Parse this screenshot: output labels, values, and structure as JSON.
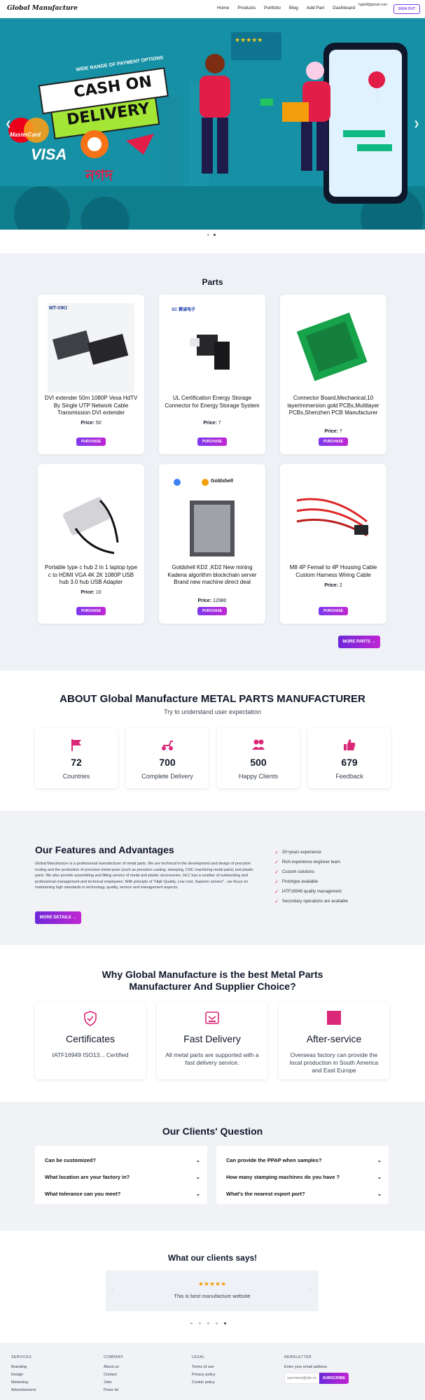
{
  "nav": {
    "brand": "Global Manufacture",
    "links": [
      "Home",
      "Products",
      "Portfolio",
      "Blog",
      "Add Part",
      "Dashboard"
    ],
    "email": "hyjbdl@gmail.com",
    "signout": "SIGN OUT"
  },
  "hero": {
    "banner_top": "WIDE RANGE OF PAYMENT OPTIONS",
    "cash": "CASH ON",
    "delivery": "DELIVERY",
    "visa": "VISA",
    "mastercard": "MasterCard",
    "bangla": "নগদ",
    "stars": "★★★★★",
    "slides": 2,
    "active_slide": 2
  },
  "parts": {
    "title": "Parts",
    "price_label": "Price:",
    "purchase_label": "PURCHASE",
    "more_label": "MORE PARTS",
    "items": [
      {
        "name": "DVI extender 50m 1080P Vesa HdTV By Single UTP Network Cable Transmission DVI extender",
        "price": "50",
        "logo": "MT-VIKI"
      },
      {
        "name": "UL Certification Energy Storage Connector for Energy Storage System",
        "price": "7",
        "logo": "SC 赛诚电子"
      },
      {
        "name": "Connector Board,Mechanical,10 layerImmersion gold PCBs,Multilayer PCBs,Shenzhen PCB Manufacturer",
        "price": "7",
        "logo": ""
      },
      {
        "name": "Portable type c hub 2 in 1 laptop type c to HDMI VGA 4K 2K 1080P USB hub 3.0 hub USB Adapter",
        "price": "10",
        "logo": ""
      },
      {
        "name": "Goldshell KD2 ,KD2 New mining Kadena algorithm blockchain server Brand new machine direct deal",
        "price": "12980",
        "logo": "Goldshell"
      },
      {
        "name": "M8 4P Femail to 4P Housing Cable Custom Harness Wiring Cable",
        "price": "2",
        "logo": ""
      }
    ]
  },
  "about": {
    "title": "ABOUT Global Manufacture METAL PARTS MANUFACTURER",
    "subtitle": "Try to understand user expectation",
    "stats": [
      {
        "num": "72",
        "label": "Countries",
        "icon": "flag-icon"
      },
      {
        "num": "700",
        "label": "Complete Delivery",
        "icon": "scooter-icon"
      },
      {
        "num": "500",
        "label": "Happy Clients",
        "icon": "users-icon"
      },
      {
        "num": "679",
        "label": "Feedback",
        "icon": "thumbs-up-icon"
      }
    ]
  },
  "features": {
    "title": "Our Features and Advantages",
    "body": "Global Manufacture is a professional manufacturer of metal parts. We are technical in the development and design of precision tooling and the production of precision metal parts (such as precision casting, stamping, CNC machining metal parts) and plastic parts. We also provide assembling and fitting service of metal and plastic accessories. HLC has a number of outstanding and professional management and technical employees. With principle of \"High Quality, Low cost, Superior service\" , we focus on maintaining high standards in technology, quality, service and management aspects.",
    "button": "MORE DETAILS",
    "checks": [
      "20+years experience",
      "Rich experience engineer team",
      "Custom solutions",
      "Prototype available",
      "IATF16949 quality management",
      "Secondary operations are available"
    ]
  },
  "why": {
    "title_line1": "Why Global Manufacture is the best Metal Parts",
    "title_line2": "Manufacturer And Supplier Choice?",
    "cards": [
      {
        "title": "Certificates",
        "desc": "IATF16949 ISO13... Certified",
        "icon": "shield-check-icon"
      },
      {
        "title": "Fast Delivery",
        "desc": "All metal parts are supported with a fast delivery service.",
        "icon": "truck-icon"
      },
      {
        "title": "After-service",
        "desc": "Overseas factory can provide the local production in South America and East Europe",
        "icon": "square-icon"
      }
    ]
  },
  "faq": {
    "title": "Our Clients' Question",
    "left": [
      "Can be customized?",
      "What location are your factory in?",
      "What tolerance can you meet?"
    ],
    "right": [
      "Can provide the PPAP when samples?",
      "How many stamping machines do you have ?",
      "What's the nearest export port?"
    ]
  },
  "testimonials": {
    "title": "What our clients says!",
    "stars": "★★★★★",
    "quote": "This is best manufacture website",
    "count": 5,
    "active": 5
  },
  "footer": {
    "services": {
      "heading": "SERVICES",
      "links": [
        "Branding",
        "Design",
        "Marketing",
        "Advertisement"
      ]
    },
    "company": {
      "heading": "COMPANY",
      "links": [
        "About us",
        "Contact",
        "Jobs",
        "Press kit"
      ]
    },
    "legal": {
      "heading": "LEGAL",
      "links": [
        "Terms of use",
        "Privacy policy",
        "Cookie policy"
      ]
    },
    "newsletter": {
      "heading": "NEWSLETTER",
      "label": "Enter your email address",
      "placeholder": "username@site.com",
      "button": "SUBSCRIBE"
    }
  },
  "colors": {
    "accent": "#7c3aed",
    "magenta": "#c026d3",
    "pink": "#db2777",
    "hero": "#1590a4"
  }
}
